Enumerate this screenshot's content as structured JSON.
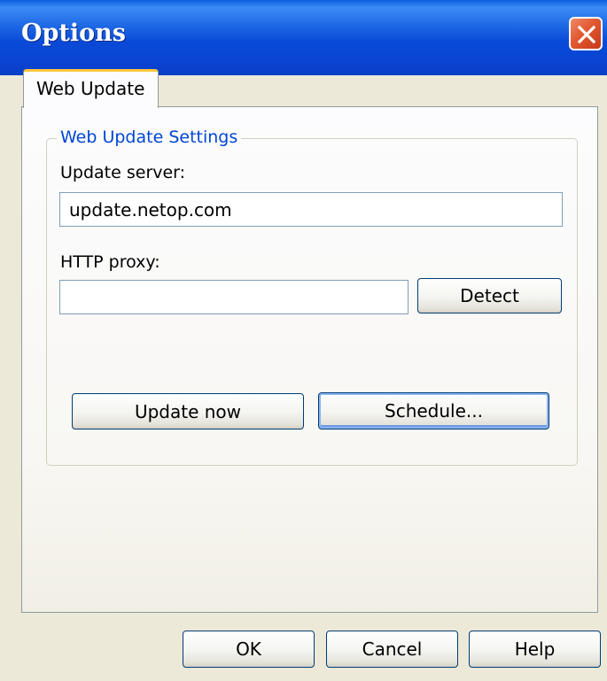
{
  "window": {
    "title": "Options",
    "close_icon": "close-icon"
  },
  "tabs": [
    {
      "label": "Web Update",
      "selected": true
    }
  ],
  "web_update": {
    "group_title": "Web Update Settings",
    "update_server_label": "Update server:",
    "update_server_value": "update.netop.com",
    "http_proxy_label": "HTTP proxy:",
    "http_proxy_value": "",
    "detect_label": "Detect",
    "update_now_label": "Update now",
    "schedule_label": "Schedule..."
  },
  "footer": {
    "ok_label": "OK",
    "cancel_label": "Cancel",
    "help_label": "Help"
  },
  "colors": {
    "titlebar": "#0a4ad8",
    "dialog_bg": "#ece9d8",
    "group_title": "#0046d5",
    "tab_highlight": "#ffc83c",
    "close_button": "#e2582e"
  }
}
